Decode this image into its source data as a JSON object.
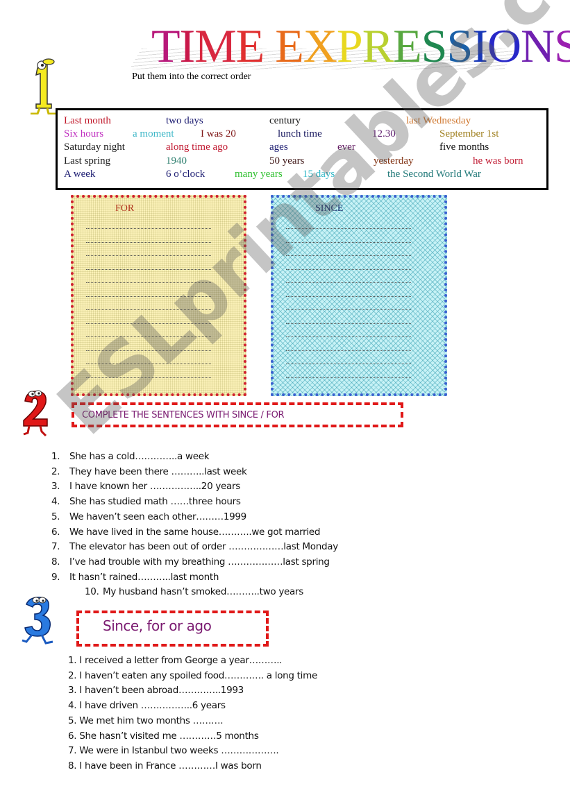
{
  "title": {
    "text": "TIME EXPRESSIONS",
    "letter_colors": [
      "#b8187a",
      "#c9184a",
      "#d82840",
      "#e03030",
      "#ffffff",
      "#e86a1a",
      "#f0a020",
      "#e8d820",
      "#b8d030",
      "#58a840",
      "#208850",
      "#1a60a8",
      "#1838b8",
      "#2828c8",
      "#7020b0",
      "#9a20b0"
    ],
    "subtitle": "Put them into the correct order"
  },
  "icons": {
    "section1": "number-one-cartoon-icon",
    "section2": "number-two-cartoon-icon",
    "section3": "number-three-cartoon-icon"
  },
  "section_numbers": [
    "1",
    "2",
    "3"
  ],
  "word_box": {
    "rows": [
      [
        {
          "text": "Last month",
          "color": "#c0182a"
        },
        {
          "text": "two days",
          "color": "#1a1a70"
        },
        {
          "text": "century",
          "color": "#202020"
        },
        {
          "text": "last Wednesday",
          "color": "#d07830"
        }
      ],
      [
        {
          "text": "Six hours",
          "color": "#c030c0"
        },
        {
          "text": "a moment",
          "color": "#40b8c8"
        },
        {
          "text": "I was 20",
          "color": "#801818"
        },
        {
          "text": "lunch time",
          "color": "#1a1a60"
        },
        {
          "text": "12.30",
          "color": "#602070"
        },
        {
          "text": "September 1st",
          "color": "#a08020"
        }
      ],
      [
        {
          "text": "Saturday night",
          "color": "#202020"
        },
        {
          "text": "along time ago",
          "color": "#c01830"
        },
        {
          "text": "ages",
          "color": "#1a1a70"
        },
        {
          "text": "ever",
          "color": "#601860"
        },
        {
          "text": "five months",
          "color": "#101010"
        }
      ],
      [
        {
          "text": "Last spring",
          "color": "#202020"
        },
        {
          "text": "1940",
          "color": "#308070"
        },
        {
          "text": "50 years",
          "color": "#401818"
        },
        {
          "text": "yesterday",
          "color": "#803010"
        },
        {
          "text": "he was born",
          "color": "#c01830"
        }
      ],
      [
        {
          "text": "A week",
          "color": "#1a1a70"
        },
        {
          "text": "6 o’clock",
          "color": "#1a1a70"
        },
        {
          "text": "many years",
          "color": "#30c030"
        },
        {
          "text": "15 days",
          "color": "#30b8c8"
        },
        {
          "text": "the Second World War",
          "color": "#207878"
        }
      ]
    ]
  },
  "for_box": {
    "title": "FOR",
    "line_count": 12,
    "border_color": "#d02030",
    "fill_color": "#fbf1b8"
  },
  "since_box": {
    "title": "SINCE",
    "line_count": 12,
    "border_color": "#3a60d0",
    "fill_color": "#c7f2f6"
  },
  "section2": {
    "header": "COMPLETE  THE SENTENCES WITH SINCE / FOR",
    "sentences": [
      {
        "n": "1.",
        "text": "She has a cold…………..a week"
      },
      {
        "n": "2.",
        "text": "They have been there ………..last week"
      },
      {
        "n": "3.",
        "text": "I have known her ……………..20 years"
      },
      {
        "n": "4.",
        "text": "She has studied math ……three hours"
      },
      {
        "n": "5.",
        "text": "We haven’t seen each other………1999"
      },
      {
        "n": "6.",
        "text": "We have lived in the same house………..we got married"
      },
      {
        "n": "7.",
        "text": "The elevator has been out of order ………………last Monday"
      },
      {
        "n": "8.",
        "text": "I’ve had trouble with my breathing ………………last spring"
      },
      {
        "n": "9.",
        "text": "It hasn’t rained………..last month"
      },
      {
        "n": "10.",
        "text": "My husband hasn’t smoked………..two years"
      }
    ]
  },
  "section3": {
    "header": "Since, for or ago",
    "sentences": [
      "1. I received a letter from George a year………..",
      "2. I haven’t eaten any spoiled food…………. a long time",
      "3. I haven’t been abroad…………..1993",
      "4. I have driven ……………..6 years",
      "5. We met him two months ……….",
      "6. She hasn’t visited me …………5 months",
      "7. We were in Istanbul two weeks ……………….",
      "8. I have been in France …………I was born"
    ]
  },
  "watermark": "ESLprintables.com"
}
